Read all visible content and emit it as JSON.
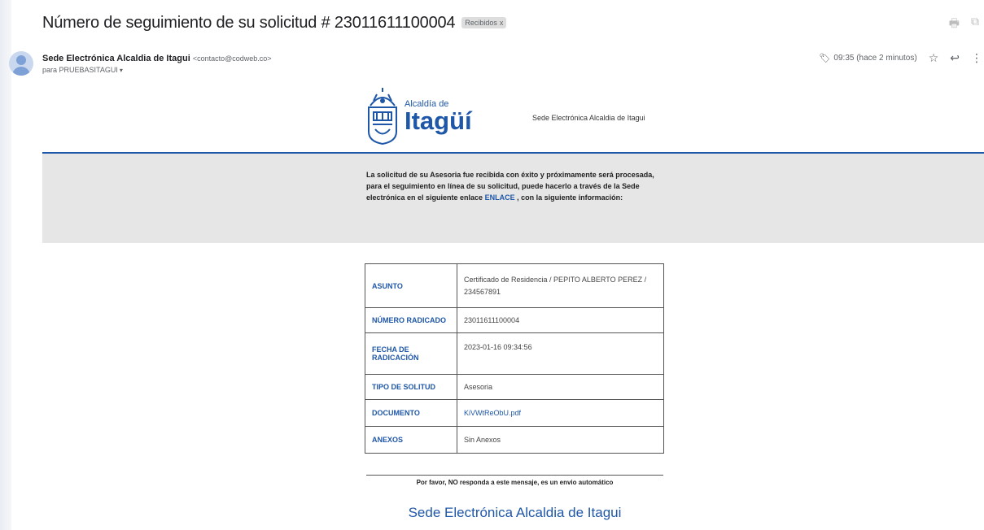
{
  "email": {
    "subject": "Número de seguimiento de su solicitud # 23011611100004",
    "label": "Recibidos",
    "label_close": "x",
    "sender_name": "Sede Electrónica Alcaldia de Itagui",
    "sender_email": "<contacto@codweb.co>",
    "to": "para PRUEBASITAGUI",
    "timestamp": "09:35 (hace 2 minutos)"
  },
  "logo": {
    "line1": "Alcaldía de",
    "line2": "Itagüí",
    "side_text": "Sede Electrónica Alcaldia de Itagui"
  },
  "notice": {
    "text_before": "La solicitud de su Asesoria fue recibida con éxito y próximamente será procesada, para el seguimiento en línea de su solicitud, puede hacerlo a través de la Sede electrónica en el siguiente enlace",
    "link": "ENLACE",
    "text_after": ", con la siguiente información:"
  },
  "details": [
    {
      "key": "ASUNTO",
      "value": "Certificado de Residencia / PEPITO ALBERTO PEREZ / 234567891"
    },
    {
      "key": "NÚMERO RADICADO",
      "value": "23011611100004"
    },
    {
      "key": "FECHA DE RADICACIÓN",
      "value": "2023-01-16 09:34:56"
    },
    {
      "key": "TIPO DE SOLITUD",
      "value": "Asesoria"
    },
    {
      "key": "DOCUMENTO",
      "value": "KiVWtReObU.pdf"
    },
    {
      "key": "ANEXOS",
      "value": "Sin Anexos"
    }
  ],
  "footer": {
    "note": "Por favor, NO responda a este mensaje, es un envio automático",
    "brand": "Sede Electrónica Alcaldia de Itagui"
  },
  "icons": {
    "print": "print-icon",
    "open_new": "open-in-new-icon",
    "attachment": "label-icon",
    "star": "star-icon",
    "reply": "reply-icon",
    "more": "more-vert-icon"
  },
  "colors": {
    "brand_blue": "#1f57a8",
    "band_grey": "#e6e6e6"
  }
}
